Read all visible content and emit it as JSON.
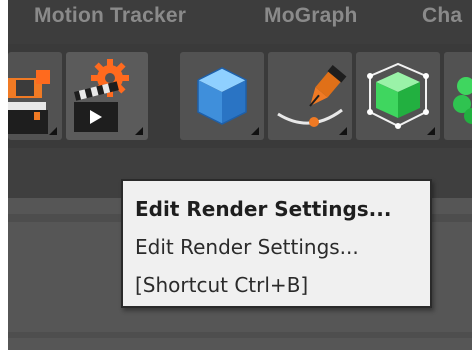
{
  "menubar": {
    "items": [
      "Motion Tracker",
      "MoGraph",
      "Cha"
    ]
  },
  "toolbar": {
    "tools": [
      {
        "icon": "render-region-clapper-icon"
      },
      {
        "icon": "edit-render-settings-icon"
      },
      {
        "icon": "cube-icon"
      },
      {
        "icon": "pen-spline-icon"
      },
      {
        "icon": "subdivision-cube-icon"
      },
      {
        "icon": "cloner-icon"
      }
    ]
  },
  "tooltip": {
    "title": "Edit Render Settings...",
    "description": "Edit Render Settings...",
    "shortcut": "[Shortcut Ctrl+B]"
  },
  "colors": {
    "menubar": "#3d3d3d",
    "toolbar": "#3a3a3a",
    "tool_button": "#525252",
    "panel": "#565656",
    "tooltip_bg": "#f0f0f0",
    "cube_blue": "#4a9be0",
    "subdiv_green": "#3fd65f",
    "clapper_orange": "#f07a24"
  }
}
